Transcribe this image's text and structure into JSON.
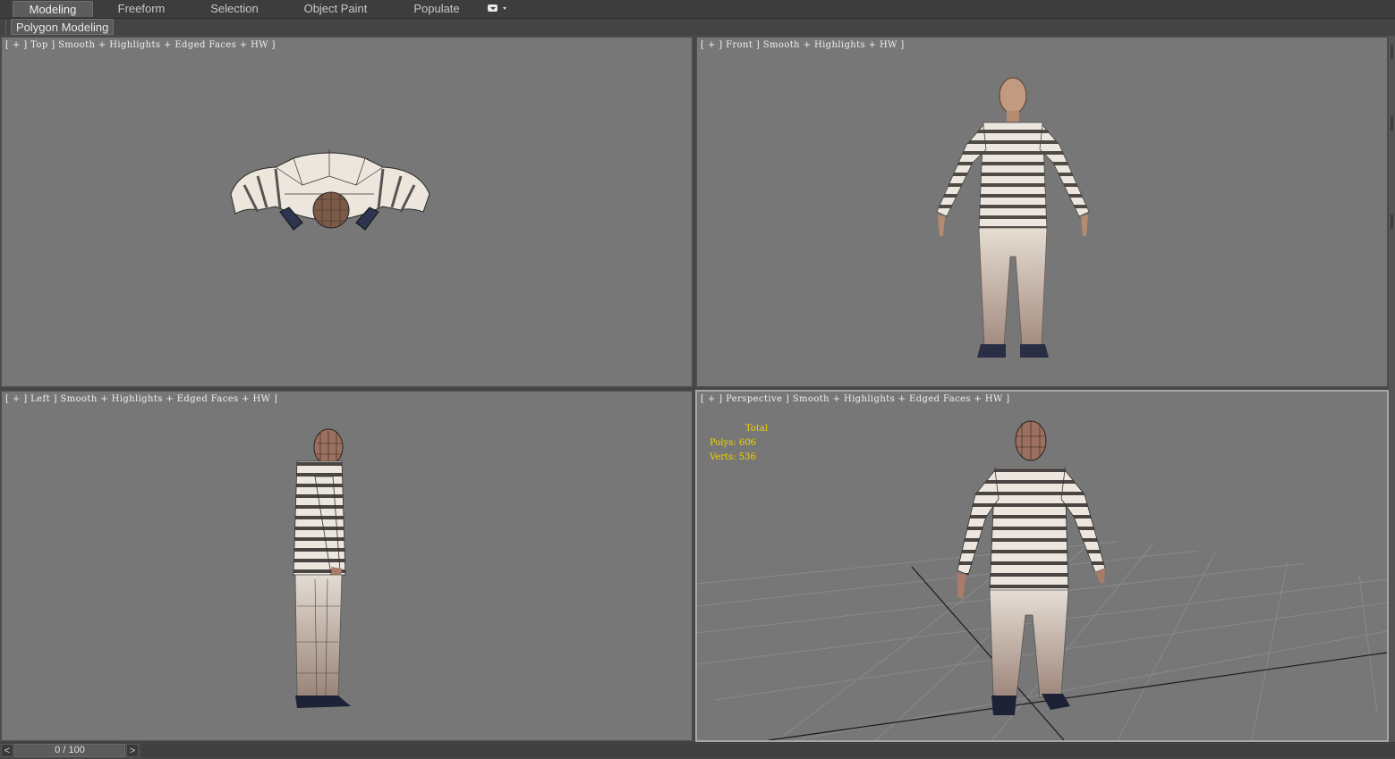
{
  "ribbon": {
    "tabs": [
      {
        "label": "Modeling",
        "active": true
      },
      {
        "label": "Freeform",
        "active": false
      },
      {
        "label": "Selection",
        "active": false
      },
      {
        "label": "Object Paint",
        "active": false
      },
      {
        "label": "Populate",
        "active": false
      }
    ],
    "panel_label": "Polygon Modeling"
  },
  "viewports": {
    "top": {
      "label": "[ + ] Top ] Smooth + Highlights + Edged Faces + HW ]"
    },
    "front": {
      "label": "[ + ] Front ] Smooth + Highlights + HW ]"
    },
    "left": {
      "label": "[ + ] Left ] Smooth + Highlights + Edged Faces + HW ]"
    },
    "perspective": {
      "label": "[ + ] Perspective ] Smooth + Highlights + Edged Faces + HW ]",
      "stats": {
        "header": "Total",
        "polys_label": "Polys:",
        "polys_value": "606",
        "verts_label": "Verts:",
        "verts_value": "536"
      }
    }
  },
  "timeline": {
    "prev_label": "<",
    "frame_display": "0 / 100",
    "next_label": ">"
  },
  "colors": {
    "viewport_bg": "#777777",
    "stats_text": "#f2d400",
    "active_border": "#a8a8a8"
  }
}
